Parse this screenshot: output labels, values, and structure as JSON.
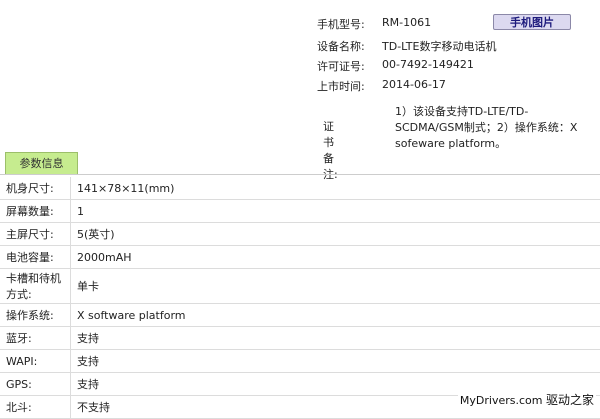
{
  "header": {
    "model_label": "手机型号:",
    "model_value": "RM-1061",
    "photo_button": "手机图片",
    "device_name_label": "设备名称:",
    "device_name_value": "TD-LTE数字移动电话机",
    "license_label": "许可证号:",
    "license_value": "00-7492-149421",
    "release_label": "上市时间:",
    "release_value": "2014-06-17",
    "remark_label": "证书备注:",
    "remark_value": "1）该设备支持TD-LTE/TD-SCDMA/GSM制式；2）操作系统：X sofeware platform。"
  },
  "tab": {
    "label": "参数信息"
  },
  "specs": [
    {
      "key": "机身尺寸:",
      "value": "141×78×11(mm)"
    },
    {
      "key": "屏幕数量:",
      "value": "1"
    },
    {
      "key": "主屏尺寸:",
      "value": "5(英寸)"
    },
    {
      "key": "电池容量:",
      "value": "2000mAH"
    },
    {
      "key": "卡槽和待机方式:",
      "value": "单卡"
    },
    {
      "key": "操作系统:",
      "value": "X software platform"
    },
    {
      "key": "蓝牙:",
      "value": "支持"
    },
    {
      "key": "WAPI:",
      "value": "支持"
    },
    {
      "key": "GPS:",
      "value": "支持"
    },
    {
      "key": "北斗:",
      "value": "不支持"
    }
  ],
  "watermark": {
    "site": "MyDrivers.com",
    "cn": "驱动之家"
  }
}
